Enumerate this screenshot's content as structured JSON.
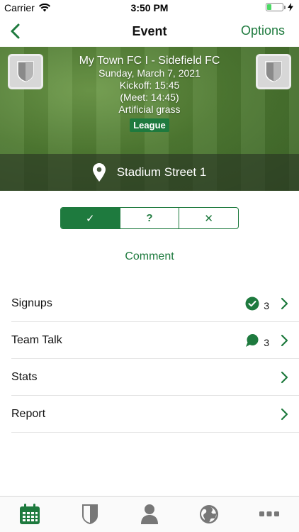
{
  "status_bar": {
    "carrier": "Carrier",
    "time": "3:50 PM",
    "battery_level": 0.3
  },
  "nav": {
    "title": "Event",
    "options_label": "Options"
  },
  "event": {
    "match_title": "My Town FC I - Sidefield FC",
    "date": "Sunday, March 7, 2021",
    "kickoff": "Kickoff: 15:45",
    "meet": "(Meet: 14:45)",
    "surface": "Artificial grass",
    "badge": "League",
    "location": "Stadium Street 1"
  },
  "response_options": {
    "accept": "✓",
    "maybe": "?",
    "decline": "✕",
    "selected": "accept"
  },
  "comment_label": "Comment",
  "rows": [
    {
      "label": "Signups",
      "count": "3",
      "icon": "check-circle-icon"
    },
    {
      "label": "Team Talk",
      "count": "3",
      "icon": "chat-bubble-icon"
    },
    {
      "label": "Stats"
    },
    {
      "label": "Report"
    }
  ],
  "tabs": [
    {
      "icon": "calendar-icon",
      "active": true
    },
    {
      "icon": "shield-icon",
      "active": false
    },
    {
      "icon": "person-icon",
      "active": false
    },
    {
      "icon": "globe-icon",
      "active": false
    },
    {
      "icon": "more-icon",
      "active": false
    }
  ],
  "colors": {
    "accent": "#1e7a3e",
    "inactive_icon": "#777777"
  }
}
